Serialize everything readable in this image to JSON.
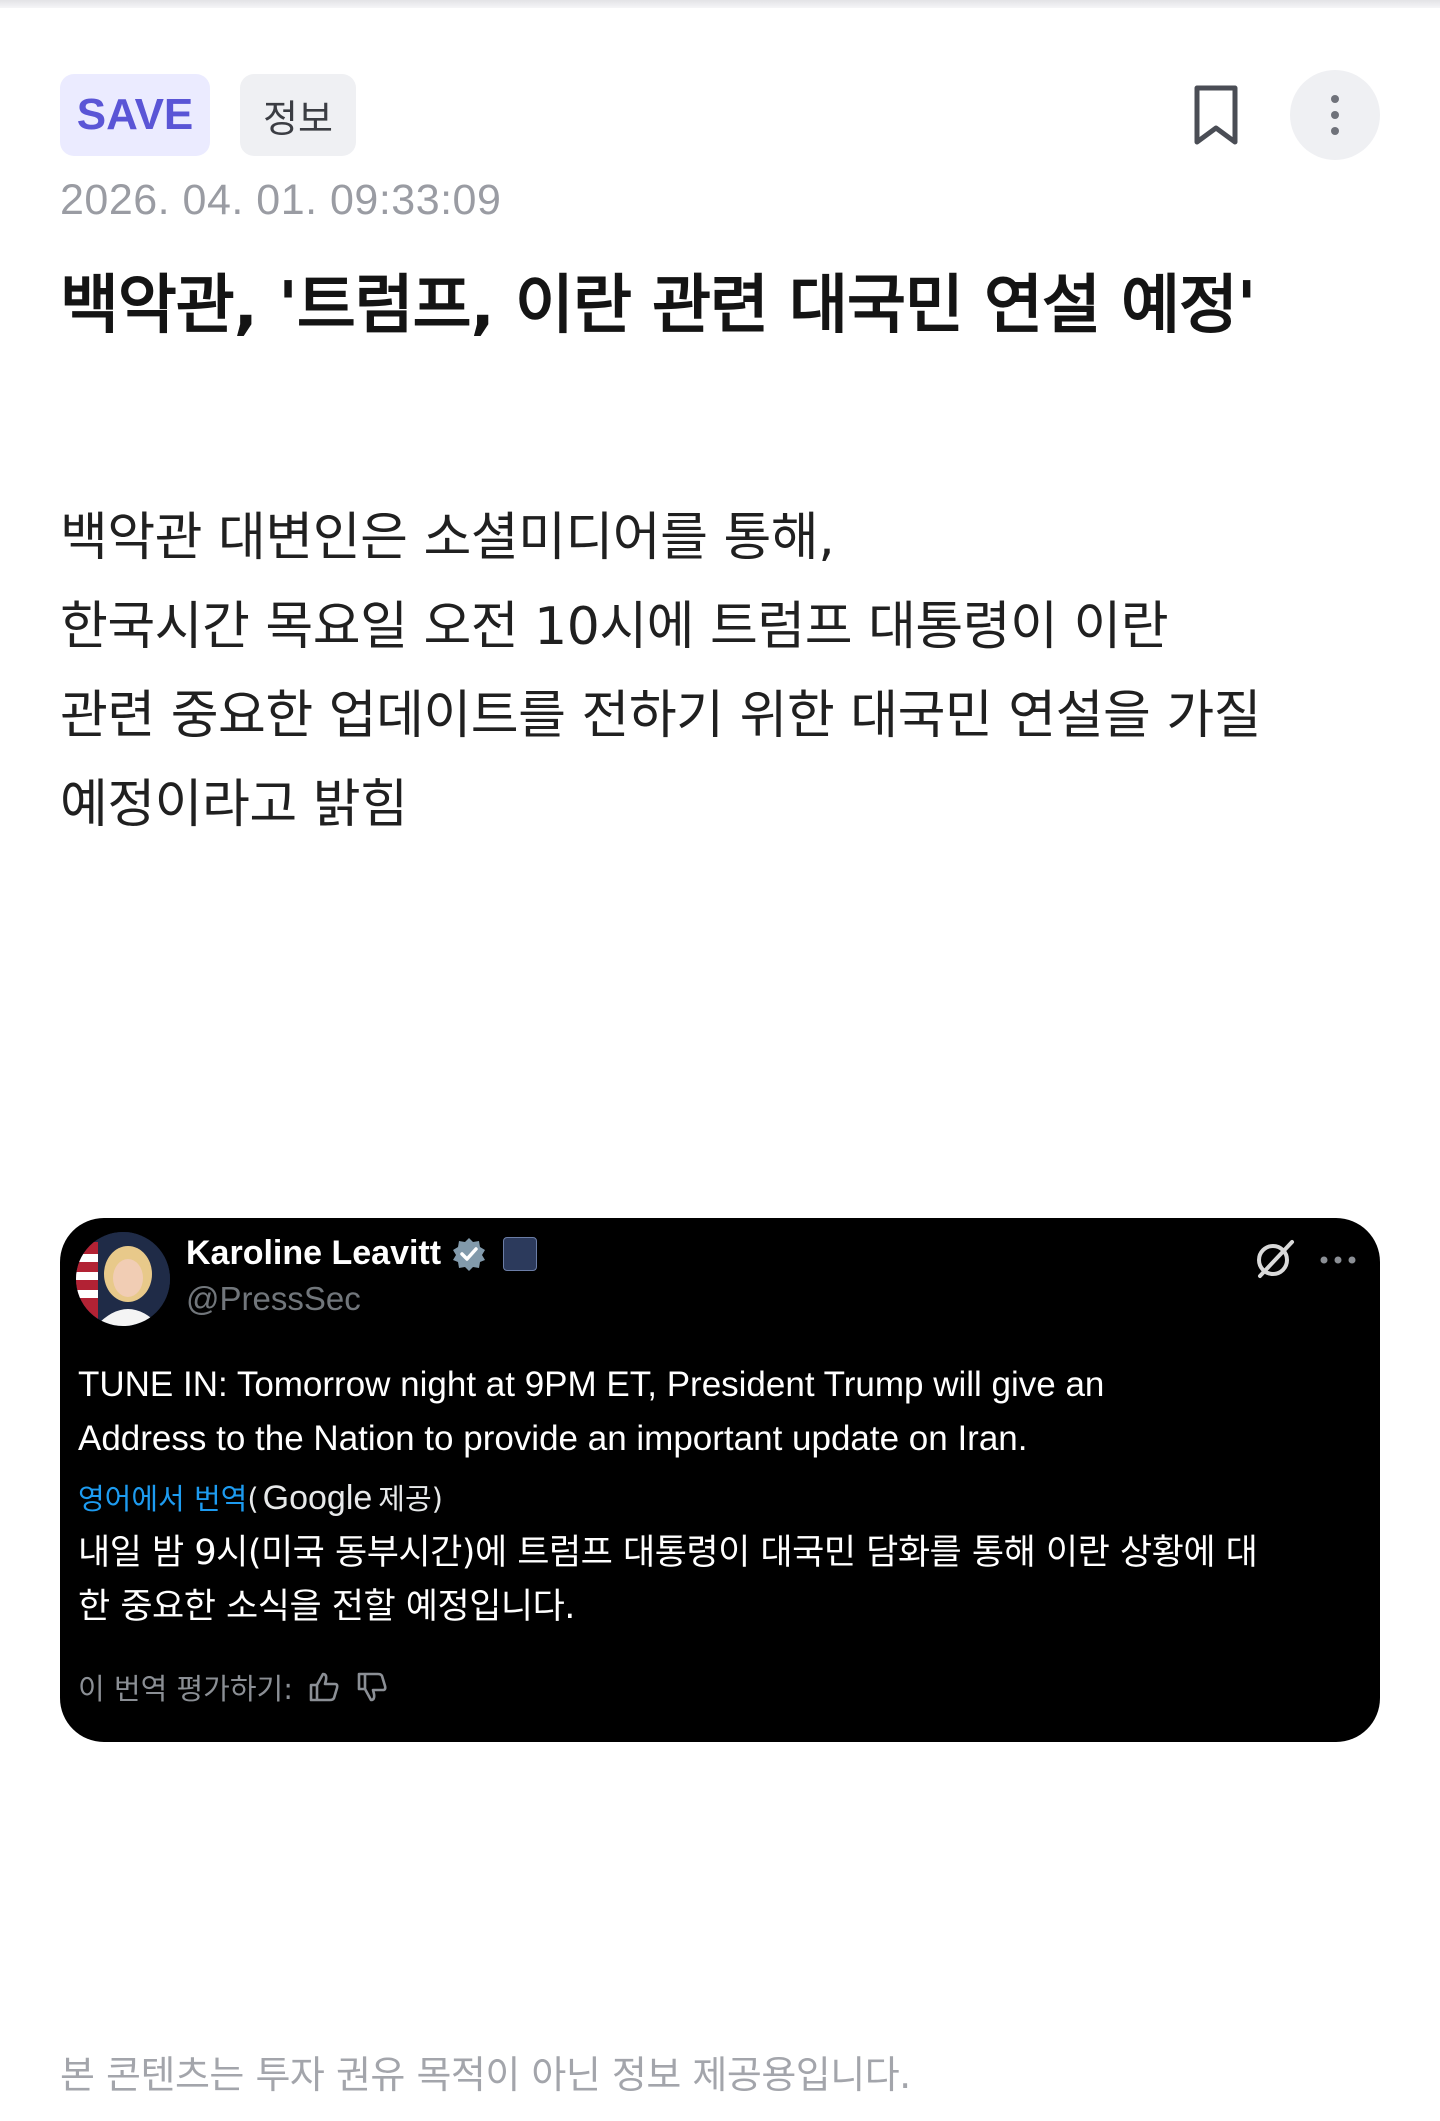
{
  "header": {
    "tags": {
      "save": "SAVE",
      "category": "정보"
    },
    "icons": {
      "bookmark": "bookmark-icon",
      "more": "more-vertical-icon"
    }
  },
  "article": {
    "timestamp": "2026. 04. 01. 09:33:09",
    "headline": "백악관, '트럼프, 이란 관련 대국민 연설 예정'",
    "body_lines": [
      "백악관 대변인은 소셜미디어를 통해,",
      "한국시간 목요일 오전 10시에 트럼프 대통령이 이란",
      "관련 중요한 업데이트를 전하기 위한 대국민 연설을 가질",
      "예정이라고 밝힘"
    ]
  },
  "tweet": {
    "author_name": "Karoline Leavitt",
    "author_handle": "@PressSec",
    "text_lines": [
      "TUNE IN: Tomorrow night at 9PM ET, President Trump will give an",
      "Address to the Nation to provide an important update on Iran."
    ],
    "translate_link": "영어에서 번역",
    "translate_paren_open": "(",
    "translate_provider": "Google",
    "translate_suffix": "제공)",
    "translated_lines": [
      "내일 밤 9시(미국 동부시간)에 트럼프 대통령이 대국민 담화를 통해 이란 상황에 대",
      "한 중요한 소식을 전할 예정입니다."
    ],
    "rate_label": "이 번역 평가하기:",
    "icons": {
      "verified": "verified-badge-icon",
      "grok": "grok-icon",
      "more": "more-horizontal-icon",
      "thumbs_up": "thumbs-up-icon",
      "thumbs_down": "thumbs-down-icon"
    },
    "colors": {
      "background": "#000000",
      "link": "#1d9bf0",
      "verified": "#829aab"
    }
  },
  "footer": {
    "disclaimer": "본 콘텐츠는 투자 권유 목적이 아닌 정보 제공용입니다."
  },
  "colors": {
    "save_tag_bg": "#ebebff",
    "save_tag_text": "#5a55d6",
    "category_tag_bg": "#eff0f3",
    "muted_text": "#9a9ca3"
  }
}
